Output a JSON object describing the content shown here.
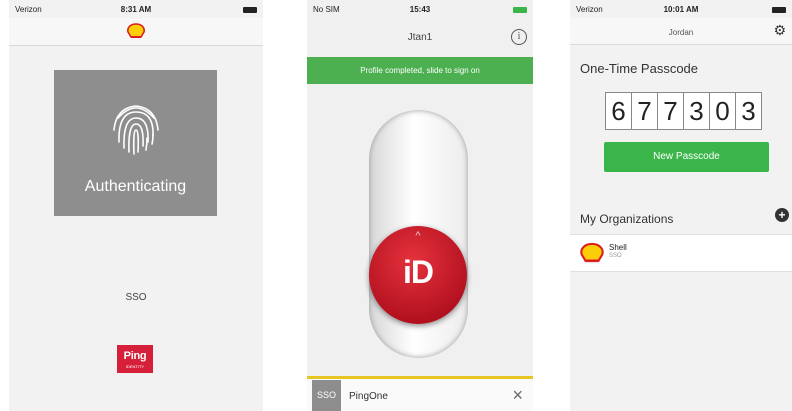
{
  "phone1": {
    "status": {
      "carrier": "Verizon",
      "time": "8:31 AM"
    },
    "auth_label": "Authenticating",
    "sso_label": "SSO",
    "ping_logo": {
      "text": "Ping",
      "subtext": "IDENTITY"
    }
  },
  "phone2": {
    "status": {
      "carrier": "No SIM",
      "time": "15:43"
    },
    "title": "Jtan1",
    "info_icon_text": "i",
    "banner": "Profile completed, slide to sign on",
    "slider_chevron": "^",
    "slider_label": "iD",
    "bottom": {
      "badge": "SSO",
      "name": "PingOne",
      "close": "×"
    }
  },
  "phone3": {
    "status": {
      "carrier": "Verizon",
      "time": "10:01 AM"
    },
    "title": "Jordan",
    "otp_title": "One-Time Passcode",
    "otp_digits": [
      "6",
      "7",
      "7",
      "3",
      "0",
      "3"
    ],
    "new_passcode_button": "New Passcode",
    "orgs_title": "My Organizations",
    "add_icon_text": "+",
    "org": {
      "name": "Shell",
      "type": "SSO"
    }
  },
  "colors": {
    "green": "#3ab54a",
    "slider_red": "#c8102e",
    "yellow": "#e7c523",
    "ping_red": "#d6203a",
    "shell_red": "#dd1d21",
    "shell_yellow": "#fbce07"
  }
}
